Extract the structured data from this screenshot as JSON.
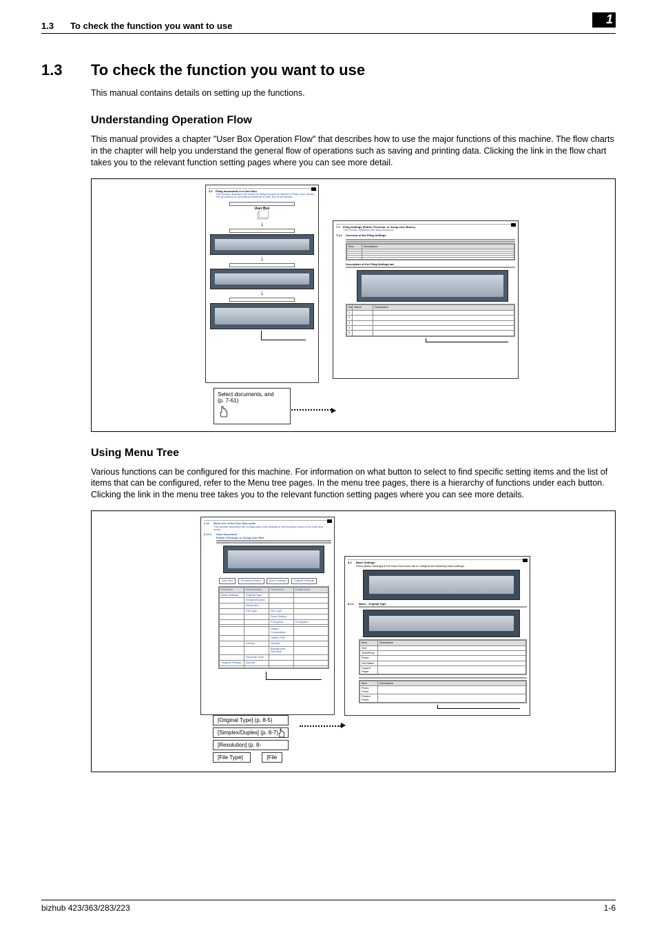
{
  "running_head": {
    "num": "1.3",
    "title": "To check the function you want to use"
  },
  "chapter_badge": "1",
  "h1": {
    "num": "1.3",
    "title": "To check the function you want to use"
  },
  "intro": "This manual contains details on setting up the functions.",
  "sec1": {
    "heading": "Understanding Operation Flow",
    "para": "This manual provides a chapter \"User Box Operation Flow\" that describes how to use the major functions of this machine. The flow charts in the chapter will help you understand the general flow of operations such as saving and printing data. Clicking the link in the flow chart takes you to the relevant function setting pages where you can see more detail."
  },
  "fig1": {
    "left_mini_title_num": "4.2",
    "left_mini_title": "Filing documents in a User Box",
    "left_mini_sub": "This section describes the steps for filing documents stored in Public User Boxes.",
    "left_mini_sub2": "The procedure for printing documents in User Box is as follows.",
    "userbox_label": "User Box",
    "callout_line1": "Select documents, and",
    "callout_line2": "(p. 7-61)",
    "right_mini_num": "7.2",
    "right_mini_title": "Filing Settings (Public, Personal, or Group User Boxes)",
    "right_mini_sub": "This section describes the filing functions.",
    "right_ov_num": "7.2.1",
    "right_ov_title": "Overview of the Filing Settings",
    "right_desc_title": "Description of the Filing Settings tab"
  },
  "sec2": {
    "heading": "Using Menu Tree",
    "para": "Various functions can be configured for this machine. For information on what button to select to find specific setting items and the list of items that can be configured, refer to the Menu tree pages. In the menu tree pages, there is a hierarchy of functions under each button. Clicking the link in the menu tree takes you to the relevant function setting pages where you can see more details."
  },
  "fig2": {
    "left_num": "6.10",
    "left_title": "Menu tree of the User Box mode",
    "left_sub": "This section describes the configuration and settings of the functions used in the User Box mode.",
    "left_sec_num": "6.10.1",
    "left_sec_title": "Save Document",
    "left_group": "Public, Personal, or Group User Box",
    "right_num": "8.2",
    "right_title": "Basic Settings",
    "right_sub": "Press [Basic Settings] in the Save Document tab to configure the following basic settings.",
    "right_num2": "8.2.1",
    "right_title2": "Basic - Original Type",
    "links": {
      "l1": "[Original Type] (p. 8-5)",
      "l2": "[Simplex/Duplex] (p. 8-7)",
      "l3": "[Resolution] (p. 8-",
      "l4a": "[File Type]",
      "l4b": "[File"
    }
  },
  "footer": {
    "left": "bizhub 423/363/283/223",
    "right": "1-6"
  }
}
